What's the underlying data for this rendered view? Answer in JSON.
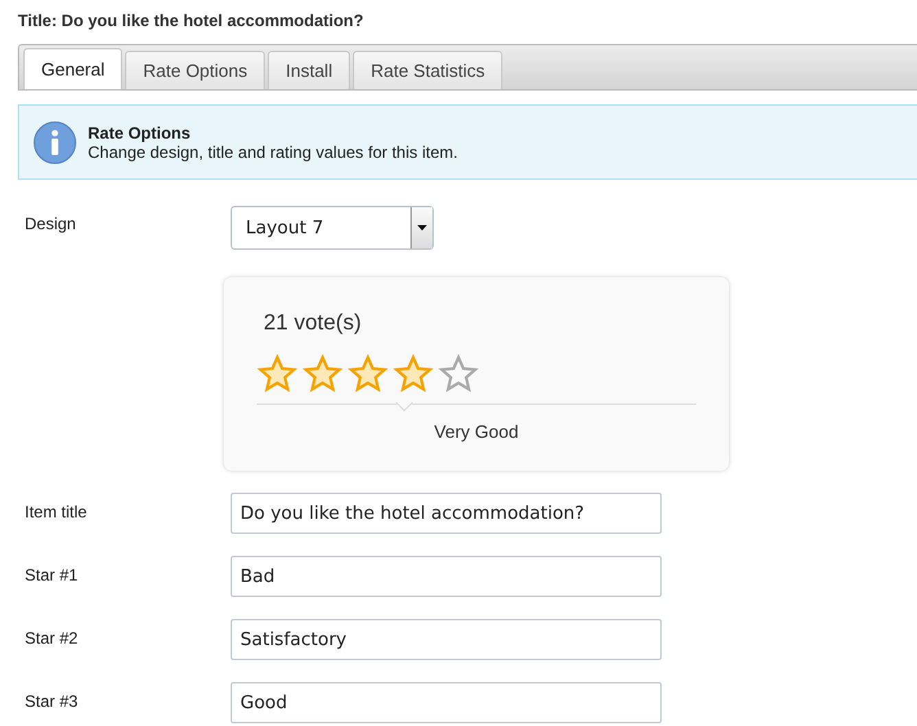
{
  "title": "Title: Do you like the hotel accommodation?",
  "tabs": [
    {
      "label": "General",
      "selected": true
    },
    {
      "label": "Rate Options",
      "selected": false
    },
    {
      "label": "Install",
      "selected": false
    },
    {
      "label": "Rate Statistics",
      "selected": false
    }
  ],
  "info": {
    "heading": "Rate Options",
    "text": "Change design, title and rating values for this item."
  },
  "design": {
    "label": "Design",
    "value": "Layout 7"
  },
  "preview": {
    "votes": "21 vote(s)",
    "stars": 4,
    "caption": "Very Good"
  },
  "fields": [
    {
      "label": "Item title",
      "value": "Do you like the hotel accommodation?"
    },
    {
      "label": "Star #1",
      "value": "Bad"
    },
    {
      "label": "Star #2",
      "value": "Satisfactory"
    },
    {
      "label": "Star #3",
      "value": "Good"
    }
  ]
}
